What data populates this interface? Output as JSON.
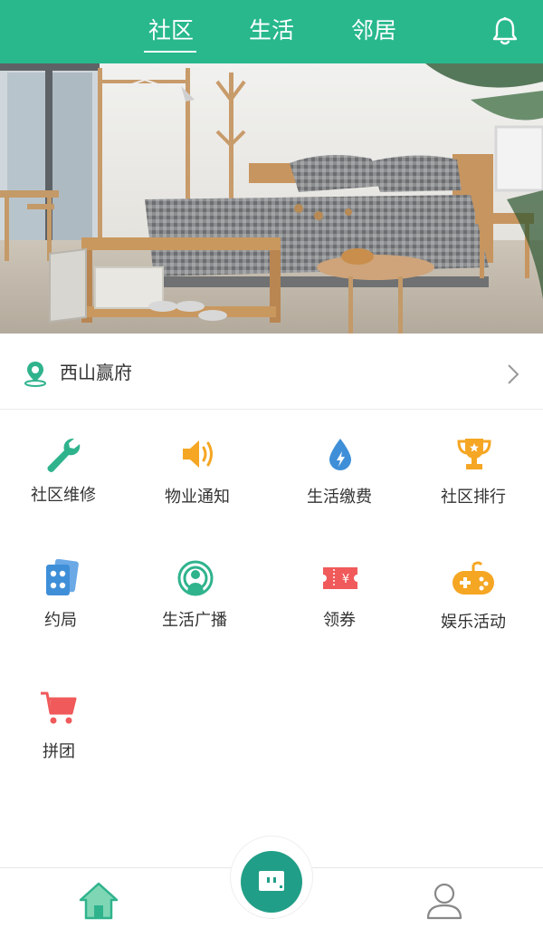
{
  "header": {
    "tabs": [
      "社区",
      "生活",
      "邻居"
    ],
    "active_tab": "社区",
    "bell_icon": "bell-icon",
    "bg_color": "#28b88c"
  },
  "banner": {
    "image": "bedroom-interior-photo"
  },
  "location": {
    "icon": "location-pin-icon",
    "name": "西山赢府",
    "chevron": "chevron-right-icon"
  },
  "grid": [
    {
      "label": "社区维修",
      "icon": "wrench-icon",
      "color": "#2fb38d"
    },
    {
      "label": "物业通知",
      "icon": "speaker-icon",
      "color": "#f5a623"
    },
    {
      "label": "生活缴费",
      "icon": "water-drop-icon",
      "color": "#3f8fd8"
    },
    {
      "label": "社区排行",
      "icon": "trophy-icon",
      "color": "#f5a623"
    },
    {
      "label": "约局",
      "icon": "playing-cards-icon",
      "color": "#3f8fd8"
    },
    {
      "label": "生活广播",
      "icon": "broadcast-icon",
      "color": "#2fb38d"
    },
    {
      "label": "领券",
      "icon": "coupon-icon",
      "color": "#f05a5a"
    },
    {
      "label": "娱乐活动",
      "icon": "gamepad-icon",
      "color": "#f5a623"
    },
    {
      "label": "拼团",
      "icon": "shopping-cart-icon",
      "color": "#f05a5a"
    }
  ],
  "bottom_nav": {
    "home_icon": "home-icon",
    "center_icon": "chat-icon",
    "user_icon": "user-icon",
    "accent": "#219e87"
  }
}
